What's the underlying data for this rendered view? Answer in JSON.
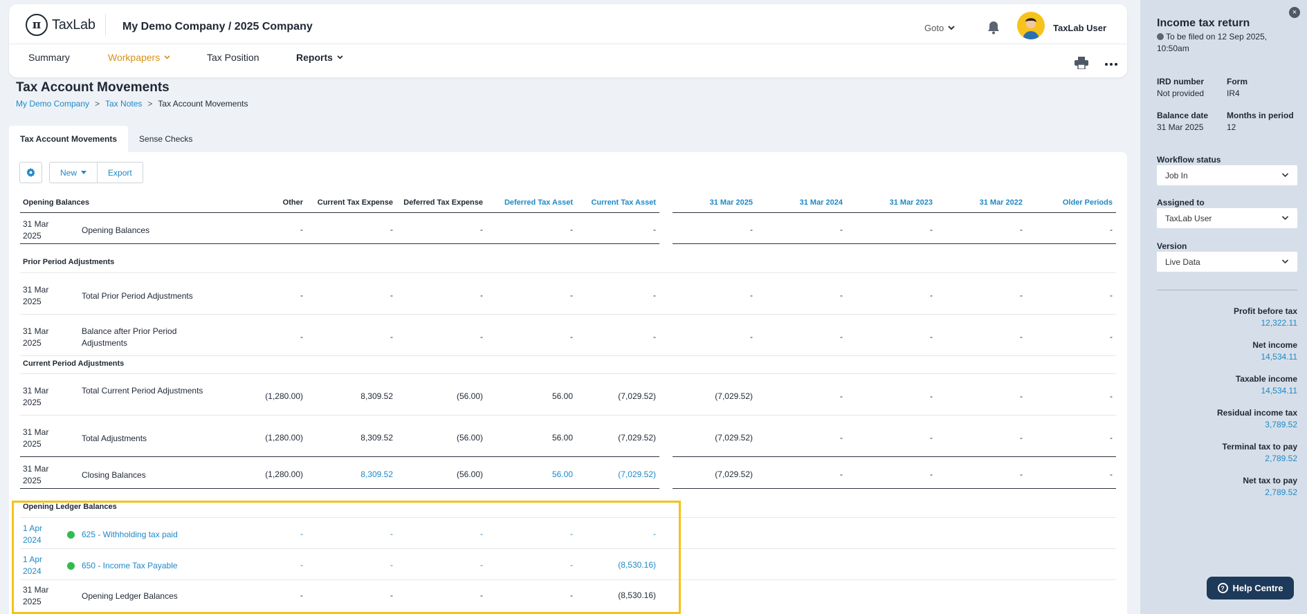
{
  "app": {
    "logo_text": "TaxLab",
    "logo_mark": "π",
    "company": "My Demo Company / 2025 Company",
    "goto": "Goto",
    "user": "TaxLab User"
  },
  "nav": {
    "summary": "Summary",
    "workpapers": "Workpapers",
    "tax_position": "Tax Position",
    "reports": "Reports"
  },
  "page": {
    "title": "Tax Account Movements"
  },
  "breadcrumb": {
    "home": "My Demo Company",
    "notes": "Tax Notes",
    "current": "Tax Account Movements",
    "sep": ">"
  },
  "tabs": {
    "movements": "Tax Account Movements",
    "sense": "Sense Checks"
  },
  "toolbar": {
    "new": "New",
    "export": "Export"
  },
  "table": {
    "headers": {
      "section": "Opening Balances",
      "other": "Other",
      "cte": "Current Tax Expense",
      "dte": "Deferred Tax Expense",
      "dta": "Deferred Tax Asset",
      "cta": "Current Tax Asset",
      "p1": "31 Mar 2025",
      "p2": "31 Mar 2024",
      "p3": "31 Mar 2023",
      "p4": "31 Mar 2022",
      "older": "Older Periods"
    },
    "sections": {
      "prior": "Prior Period Adjustments",
      "current": "Current Period Adjustments",
      "ledger": "Opening Ledger Balances"
    },
    "rows": [
      {
        "date": "31 Mar 2025",
        "desc": "Opening Balances",
        "other": "-",
        "cte": "-",
        "dte": "-",
        "dta": "-",
        "cta": "-",
        "p1": "-",
        "p2": "-",
        "p3": "-",
        "p4": "-",
        "older": "-"
      },
      {
        "date": "31 Mar 2025",
        "desc": "Total Prior Period Adjustments",
        "other": "-",
        "cte": "-",
        "dte": "-",
        "dta": "-",
        "cta": "-",
        "p1": "-",
        "p2": "-",
        "p3": "-",
        "p4": "-",
        "older": "-"
      },
      {
        "date": "31 Mar 2025",
        "desc": "Balance after Prior Period Adjustments",
        "other": "-",
        "cte": "-",
        "dte": "-",
        "dta": "-",
        "cta": "-",
        "p1": "-",
        "p2": "-",
        "p3": "-",
        "p4": "-",
        "older": "-"
      },
      {
        "date": "31 Mar 2025",
        "desc": "Total Current Period Adjustments",
        "other": "(1,280.00)",
        "cte": "8,309.52",
        "dte": "(56.00)",
        "dta": "56.00",
        "cta": "(7,029.52)",
        "p1": "(7,029.52)",
        "p2": "-",
        "p3": "-",
        "p4": "-",
        "older": "-"
      },
      {
        "date": "31 Mar 2025",
        "desc": "Total Adjustments",
        "other": "(1,280.00)",
        "cte": "8,309.52",
        "dte": "(56.00)",
        "dta": "56.00",
        "cta": "(7,029.52)",
        "p1": "(7,029.52)",
        "p2": "-",
        "p3": "-",
        "p4": "-",
        "older": "-"
      },
      {
        "date": "31 Mar 2025",
        "desc": "Closing Balances",
        "other": "(1,280.00)",
        "cte": "8,309.52",
        "dte": "(56.00)",
        "dta": "56.00",
        "cta": "(7,029.52)",
        "p1": "(7,029.52)",
        "p2": "-",
        "p3": "-",
        "p4": "-",
        "older": "-"
      },
      {
        "date": "1 Apr 2024",
        "desc": "625 - Withholding tax paid",
        "other": "-",
        "cte": "-",
        "dte": "-",
        "dta": "-",
        "cta": "-"
      },
      {
        "date": "1 Apr 2024",
        "desc": "650 - Income Tax Payable",
        "other": "-",
        "cte": "-",
        "dte": "-",
        "dta": "-",
        "cta": "(8,530.16)"
      },
      {
        "date": "31 Mar 2025",
        "desc": "Opening Ledger Balances",
        "other": "-",
        "cte": "-",
        "dte": "-",
        "dta": "-",
        "cta": "(8,530.16)"
      }
    ]
  },
  "panel": {
    "title": "Income tax return",
    "filed": "To be filed on 12 Sep 2025, 10:50am",
    "ird_label": "IRD number",
    "ird_value": "Not provided",
    "form_label": "Form",
    "form_value": "IR4",
    "balance_label": "Balance date",
    "balance_value": "31 Mar 2025",
    "months_label": "Months in period",
    "months_value": "12",
    "workflow_label": "Workflow status",
    "workflow_value": "Job In",
    "assigned_label": "Assigned to",
    "assigned_value": "TaxLab User",
    "version_label": "Version",
    "version_value": "Live Data",
    "metrics": [
      {
        "label": "Profit before tax",
        "value": "12,322.11"
      },
      {
        "label": "Net income",
        "value": "14,534.11"
      },
      {
        "label": "Taxable income",
        "value": "14,534.11"
      },
      {
        "label": "Residual income tax",
        "value": "3,789.52"
      },
      {
        "label": "Terminal tax to pay",
        "value": "2,789.52"
      },
      {
        "label": "Net tax to pay",
        "value": "2,789.52"
      }
    ],
    "close": "×"
  },
  "help": {
    "label": "Help Centre",
    "icon": "?"
  },
  "colors": {
    "accent": "#1e88c7",
    "active_nav": "#d69216",
    "highlight": "#f5c218",
    "status_dot": "#2fbc4f"
  }
}
